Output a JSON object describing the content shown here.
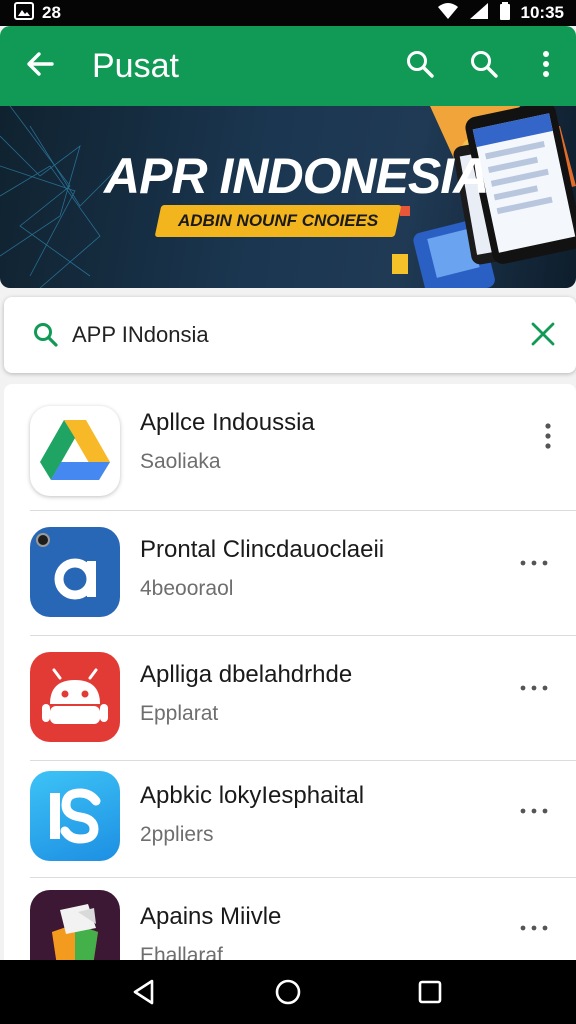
{
  "status": {
    "time": "10:35",
    "notif_count": "28"
  },
  "appbar": {
    "title": "Pusat",
    "back_icon": "arrow-back-icon",
    "search_icon": "search-icon",
    "more_icon": "more-vert-icon"
  },
  "banner": {
    "headline": "APR INDONESIA",
    "tagline": "ADBIN NOUNF CNOIEES"
  },
  "search": {
    "query": "APP INdonsia",
    "search_icon": "search-icon",
    "clear_icon": "close-icon"
  },
  "apps": [
    {
      "name": "Apllce Indoussia",
      "sub": "Saoliaka",
      "icon": "drive-triangle-icon"
    },
    {
      "name": "Prontal Clincdauoclaeii",
      "sub": "4beooraol",
      "icon": "letter-a-icon"
    },
    {
      "name": "Aplliga dbelahdrhde",
      "sub": "Epplarat",
      "icon": "android-robot-icon"
    },
    {
      "name": "Apbkic lokyIesphaital",
      "sub": "2ppliers",
      "icon": "letter-s-icon"
    },
    {
      "name": "Apains Miivle",
      "sub": "Ehallaraf",
      "icon": "colorful-box-icon"
    }
  ],
  "colors": {
    "appbar": "#109a55",
    "accent": "#109a55",
    "statusbar": "#050505"
  }
}
